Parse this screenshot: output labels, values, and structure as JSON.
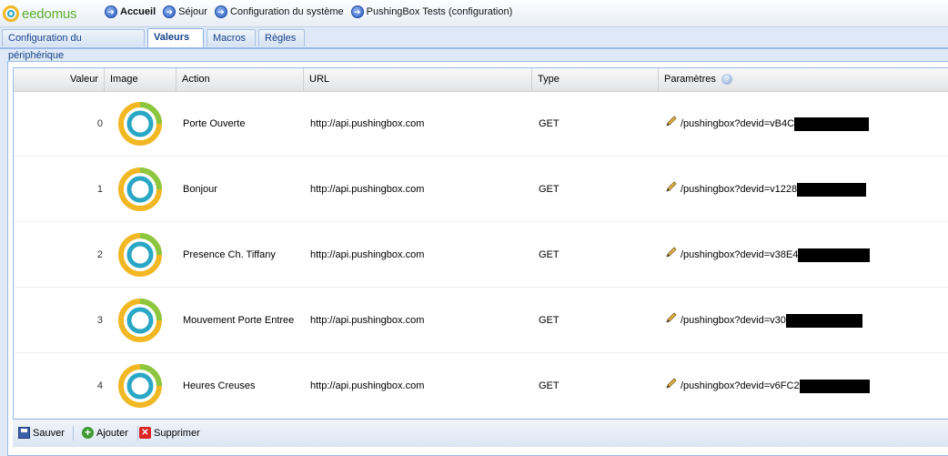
{
  "app": {
    "logo_text": "eedomus"
  },
  "breadcrumb": [
    {
      "label": "Accueil",
      "icon": "arrow-right-icon"
    },
    {
      "label": "Séjour",
      "icon": "arrow-right-icon"
    },
    {
      "label": "Configuration du système",
      "icon": "arrow-right-icon"
    },
    {
      "label": "PushingBox Tests (configuration)",
      "icon": "arrow-right-icon"
    }
  ],
  "tabs": [
    {
      "label": "Configuration du périphérique",
      "active": false
    },
    {
      "label": "Valeurs",
      "active": true
    },
    {
      "label": "Macros",
      "active": false
    },
    {
      "label": "Règles",
      "active": false
    }
  ],
  "grid": {
    "headers": {
      "valeur": "Valeur",
      "image": "Image",
      "action": "Action",
      "url": "URL",
      "type": "Type",
      "parametres": "Paramètres"
    },
    "rows": [
      {
        "valeur": "0",
        "action": "Porte Ouverte",
        "url": "http://api.pushingbox.com",
        "type": "GET",
        "parametres": "/pushingbox?devid=vB4C"
      },
      {
        "valeur": "1",
        "action": "Bonjour",
        "url": "http://api.pushingbox.com",
        "type": "GET",
        "parametres": "/pushingbox?devid=v1228"
      },
      {
        "valeur": "2",
        "action": "Presence Ch. Tiffany",
        "url": "http://api.pushingbox.com",
        "type": "GET",
        "parametres": "/pushingbox?devid=v38E4"
      },
      {
        "valeur": "3",
        "action": "Mouvement Porte Entree",
        "url": "http://api.pushingbox.com",
        "type": "GET",
        "parametres": "/pushingbox?devid=v30"
      },
      {
        "valeur": "4",
        "action": "Heures Creuses",
        "url": "http://api.pushingbox.com",
        "type": "GET",
        "parametres": "/pushingbox?devid=v6FC2"
      }
    ]
  },
  "toolbar": {
    "save_label": "Sauver",
    "add_label": "Ajouter",
    "delete_label": "Supprimer"
  },
  "colors": {
    "ring_outer": "#f2b824",
    "ring_green": "#8cc63f",
    "ring_inner": "#2aa7c4",
    "header_border": "#99bbe8"
  }
}
